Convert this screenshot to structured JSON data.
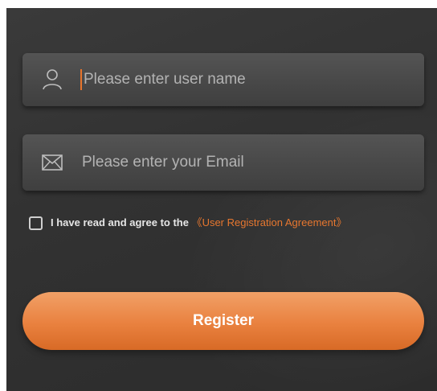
{
  "form": {
    "username": {
      "placeholder": "Please enter user name",
      "icon": "user-icon"
    },
    "email": {
      "placeholder": "Please enter your Email",
      "icon": "envelope-icon"
    },
    "agreement": {
      "checked": false,
      "text": "I have read and agree to the ",
      "link_text": "《User Registration Agreement》"
    },
    "register_label": "Register"
  },
  "colors": {
    "background": "#333333",
    "accent": "#e8742b",
    "button_gradient_top": "#f1a067",
    "button_gradient_bottom": "#d86a26"
  }
}
